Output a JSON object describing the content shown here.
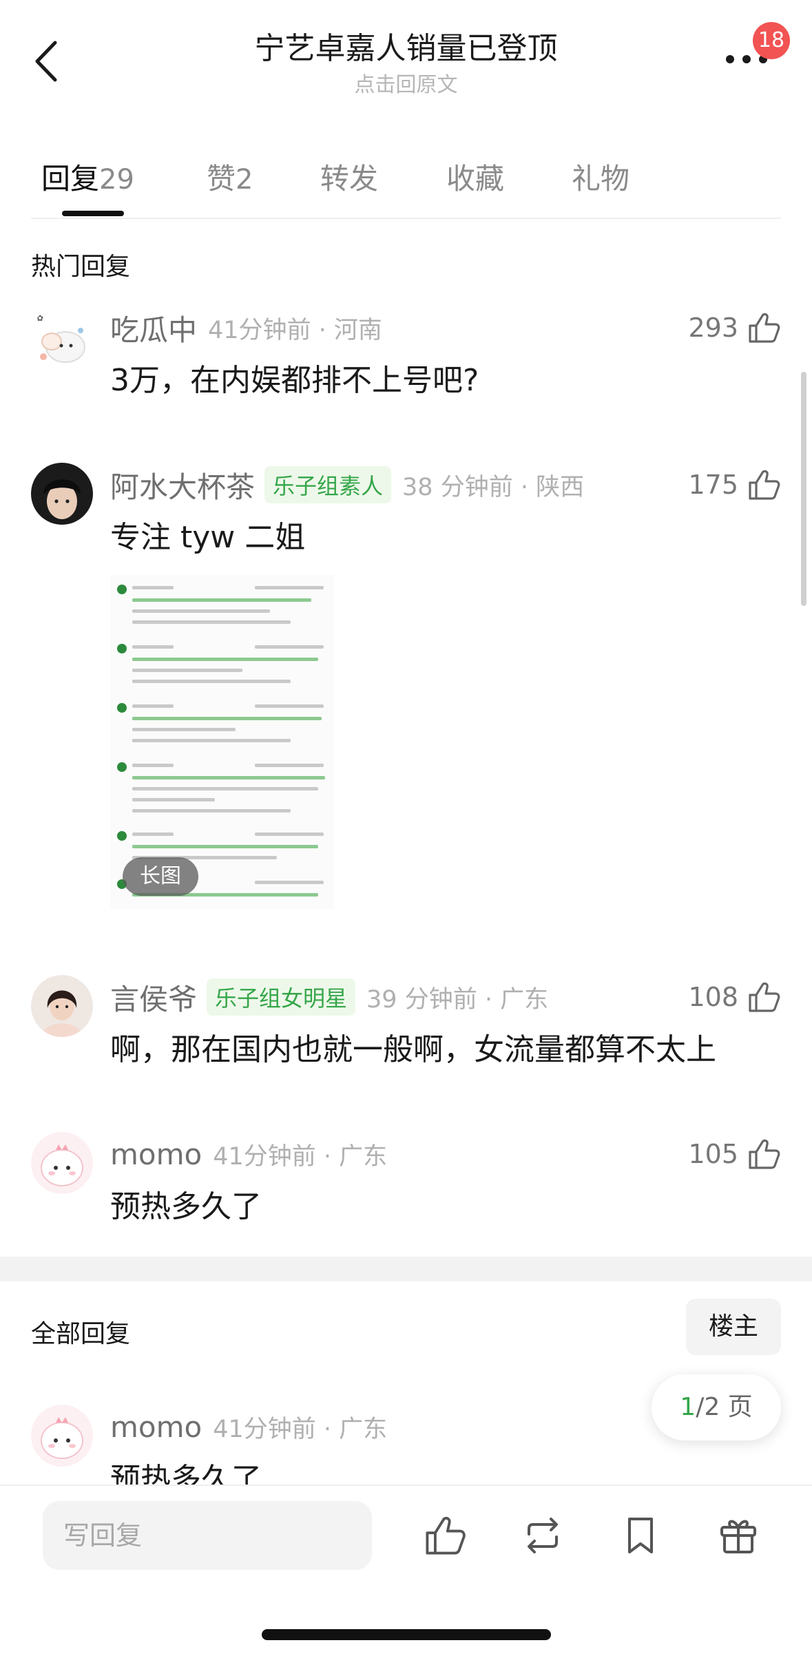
{
  "header": {
    "title": "宁艺卓嘉人销量已登顶",
    "subtitle": "点击回原文",
    "badge": "18"
  },
  "tabs": [
    {
      "label": "回复",
      "count": "29"
    },
    {
      "label": "赞",
      "count": "2"
    },
    {
      "label": "转发",
      "count": ""
    },
    {
      "label": "收藏",
      "count": ""
    },
    {
      "label": "礼物",
      "count": ""
    }
  ],
  "hot": {
    "title": "热门回复",
    "comments": [
      {
        "name": "吃瓜中",
        "tag": "",
        "time": "41分钟前 · 河南",
        "likes": "293",
        "text": "3万，在内娱都排不上号吧?"
      },
      {
        "name": "阿水大杯茶",
        "tag": "乐子组素人",
        "time": "38 分钟前 · 陕西",
        "likes": "175",
        "text": "专注 tyw 二姐",
        "image_badge": "长图"
      },
      {
        "name": "言侯爷",
        "tag": "乐子组女明星",
        "time": "39 分钟前 · 广东",
        "likes": "108",
        "text": "啊，那在国内也就一般啊，女流量都算不太上"
      },
      {
        "name": "momo",
        "tag": "",
        "time": "41分钟前 · 广东",
        "likes": "105",
        "text": "预热多久了"
      }
    ]
  },
  "all": {
    "title": "全部回复",
    "host_button": "楼主",
    "comments": [
      {
        "name": "momo",
        "time": "41分钟前 · 广东",
        "text": "预热多久了"
      }
    ]
  },
  "pager": {
    "current": "1",
    "total": "/2 页"
  },
  "bottom": {
    "placeholder": "写回复"
  },
  "colors": {
    "accent_green": "#35a64a",
    "badge_red": "#f25353"
  }
}
